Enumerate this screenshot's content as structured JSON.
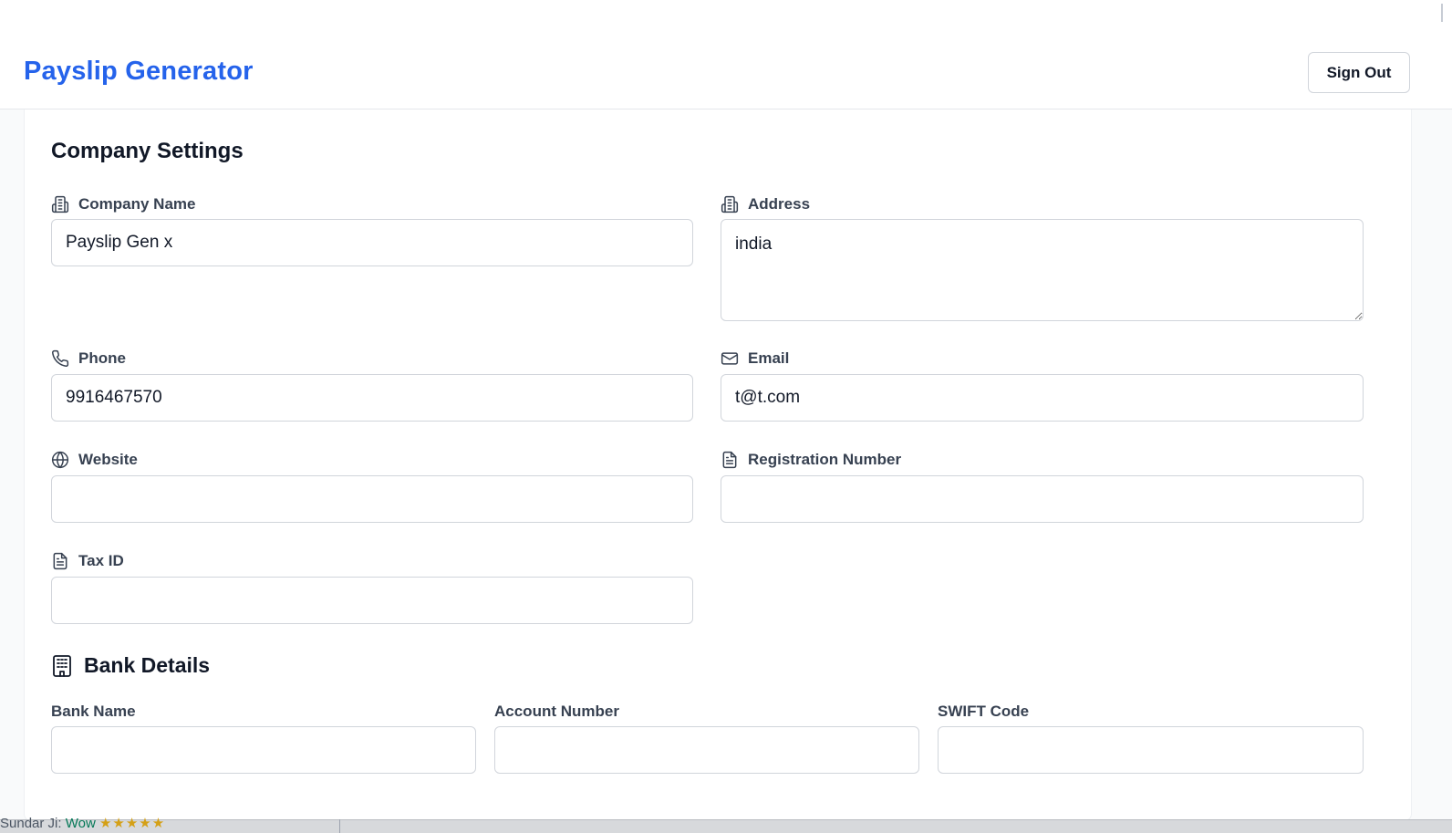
{
  "header": {
    "brand": "Payslip Generator",
    "signout_label": "Sign Out"
  },
  "company": {
    "title": "Company Settings",
    "fields": {
      "company_name": {
        "label": "Company Name",
        "value": "Payslip Gen x"
      },
      "address": {
        "label": "Address",
        "value": "india"
      },
      "phone": {
        "label": "Phone",
        "value": "9916467570"
      },
      "email": {
        "label": "Email",
        "value": "t@t.com"
      },
      "website": {
        "label": "Website",
        "value": ""
      },
      "registration_number": {
        "label": "Registration Number",
        "value": ""
      },
      "tax_id": {
        "label": "Tax ID",
        "value": ""
      }
    }
  },
  "bank": {
    "title": "Bank Details",
    "fields": {
      "bank_name": {
        "label": "Bank Name",
        "value": ""
      },
      "account_number": {
        "label": "Account Number",
        "value": ""
      },
      "swift_code": {
        "label": "SWIFT Code",
        "value": ""
      }
    }
  },
  "bottom_strip": {
    "text": "Sundar Ji:",
    "wow": "Wow",
    "stars": "★★★★★"
  },
  "colors": {
    "brand": "#2563eb",
    "border": "#d1d5db",
    "text": "#111827",
    "label": "#374151"
  }
}
